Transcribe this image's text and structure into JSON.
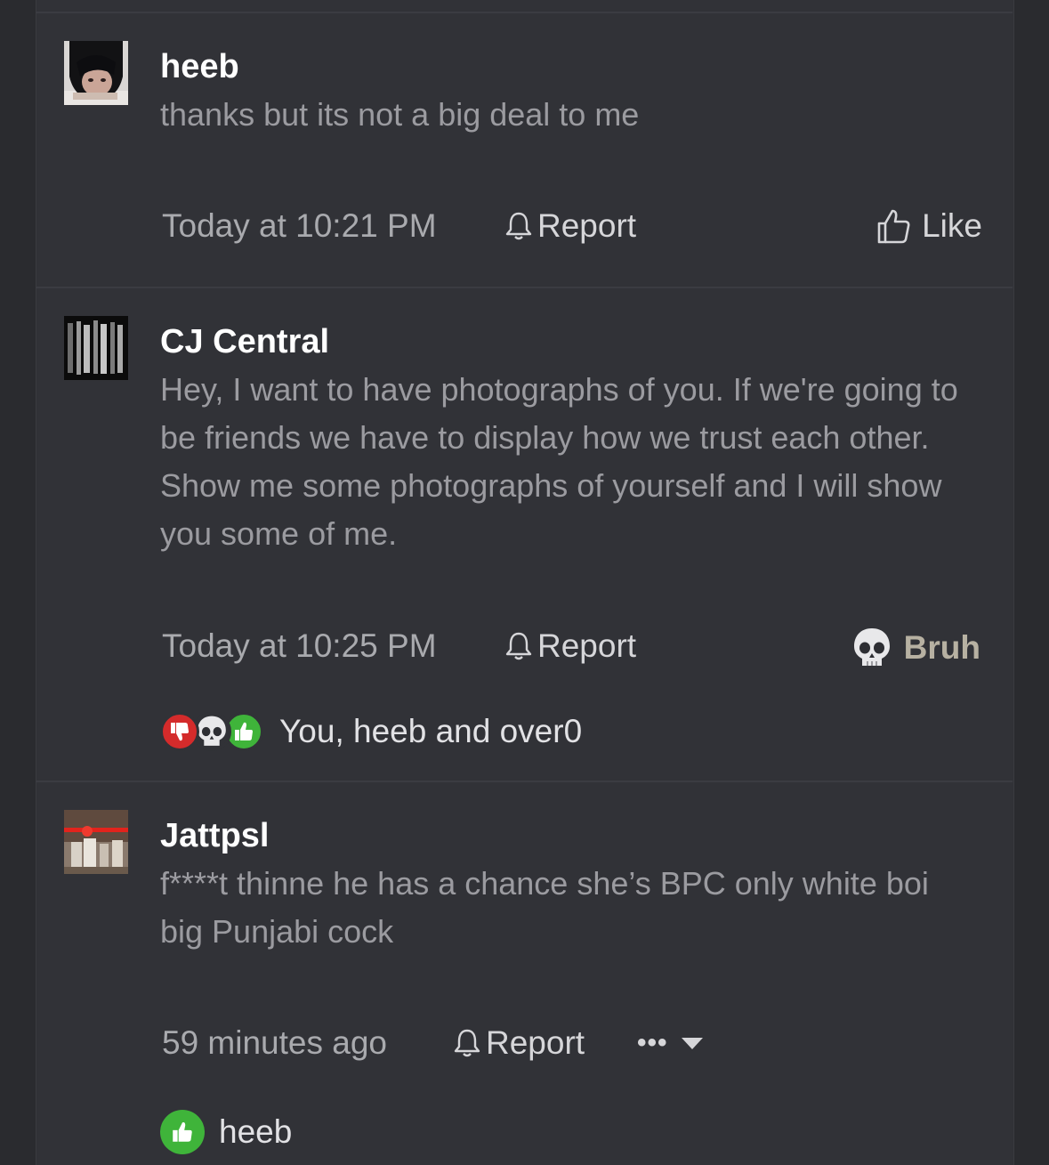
{
  "posts": [
    {
      "author": "heeb",
      "text": "thanks but its not a big deal to me",
      "time": "Today at 10:21 PM",
      "report_label": "Report",
      "reaction_label": "Like",
      "avatar_icon": "user-photo-avatar"
    },
    {
      "author": "CJ Central",
      "text": "Hey, I want to have photographs of you. If we're going to be friends we have to display how we trust each other. Show me some photographs of yourself and I will show you some of me.",
      "time": "Today at 10:25 PM",
      "report_label": "Report",
      "reaction_label": "Bruh",
      "reaction_icon": "skull-icon",
      "reactors": "You, heeb and over0",
      "reaction_icons": [
        "thumbs-down-icon",
        "skull-icon",
        "thumbs-up-icon"
      ],
      "avatar_icon": "striped-photo-avatar"
    },
    {
      "author": "Jattpsl",
      "text": "f****t thinne he has a chance she’s BPC only white boi big Punjabi cock",
      "time": "59 minutes ago",
      "report_label": "Report",
      "more_label": "•••",
      "reactors": "heeb",
      "reaction_icons": [
        "thumbs-up-icon"
      ],
      "avatar_icon": "group-photo-avatar"
    }
  ],
  "colors": {
    "background": "#313237",
    "author": "#ffffff",
    "body_text": "#9b9ba0",
    "meta_text": "#a9aaae",
    "like_green": "#3fb43a",
    "dislike_red": "#d42b2b",
    "bruh_text": "#b7b1a2"
  }
}
